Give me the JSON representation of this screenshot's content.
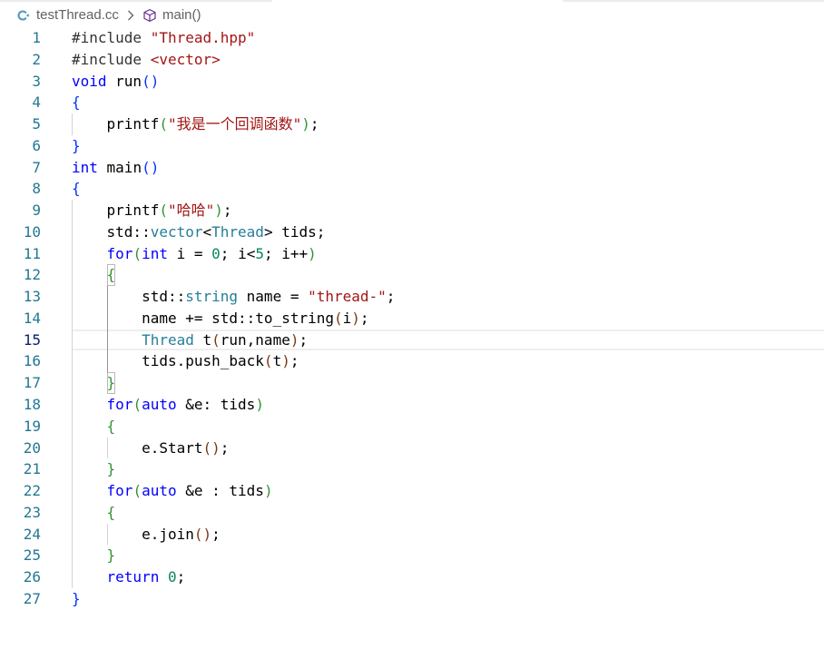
{
  "breadcrumb": {
    "file_icon": "cpp-file-icon",
    "file": "testThread.cc",
    "separator_icon": "chevron-right-icon",
    "symbol_icon": "method-cube-icon",
    "symbol": "main()"
  },
  "colors": {
    "line_number": "#237893",
    "line_number_active": "#0b216f",
    "breadcrumb_text": "#616161",
    "file_icon": "#519aba",
    "method_icon": "#652d90",
    "indent_guide": "#d3d3d3",
    "indent_guide_active": "#939393",
    "line_highlight_border": "#eeeeee",
    "bracket_match_border": "#b9b9b9",
    "tab_edge": "#ececec"
  },
  "editor": {
    "cursor_line": 15,
    "lines": [
      {
        "n": 1,
        "indent": 0,
        "tokens": [
          {
            "t": "#include ",
            "c": "#333333"
          },
          {
            "t": "\"Thread.hpp\"",
            "c": "#a31515"
          }
        ]
      },
      {
        "n": 2,
        "indent": 0,
        "tokens": [
          {
            "t": "#include ",
            "c": "#333333"
          },
          {
            "t": "<vector>",
            "c": "#a31515"
          }
        ]
      },
      {
        "n": 3,
        "indent": 0,
        "tokens": [
          {
            "t": "void",
            "c": "#0000ff"
          },
          {
            "t": " run",
            "c": "#000000"
          },
          {
            "t": "()",
            "c": "#0431fa"
          }
        ]
      },
      {
        "n": 4,
        "indent": 0,
        "tokens": [
          {
            "t": "{",
            "c": "#0431fa"
          }
        ]
      },
      {
        "n": 5,
        "indent": 1,
        "tokens": [
          {
            "t": "printf",
            "c": "#000000"
          },
          {
            "t": "(",
            "c": "#319331"
          },
          {
            "t": "\"我是一个回调函数\"",
            "c": "#a31515"
          },
          {
            "t": ")",
            "c": "#319331"
          },
          {
            "t": ";",
            "c": "#000000"
          }
        ]
      },
      {
        "n": 6,
        "indent": 0,
        "tokens": [
          {
            "t": "}",
            "c": "#0431fa"
          }
        ]
      },
      {
        "n": 7,
        "indent": 0,
        "tokens": [
          {
            "t": "int",
            "c": "#0000ff"
          },
          {
            "t": " main",
            "c": "#000000"
          },
          {
            "t": "()",
            "c": "#0431fa"
          }
        ]
      },
      {
        "n": 8,
        "indent": 0,
        "tokens": [
          {
            "t": "{",
            "c": "#0431fa"
          }
        ]
      },
      {
        "n": 9,
        "indent": 1,
        "tokens": [
          {
            "t": "printf",
            "c": "#000000"
          },
          {
            "t": "(",
            "c": "#319331"
          },
          {
            "t": "\"哈哈\"",
            "c": "#a31515"
          },
          {
            "t": ")",
            "c": "#319331"
          },
          {
            "t": ";",
            "c": "#000000"
          }
        ]
      },
      {
        "n": 10,
        "indent": 1,
        "tokens": [
          {
            "t": "std::",
            "c": "#000000"
          },
          {
            "t": "vector",
            "c": "#267f99"
          },
          {
            "t": "<",
            "c": "#000000"
          },
          {
            "t": "Thread",
            "c": "#267f99"
          },
          {
            "t": "> tids;",
            "c": "#000000"
          }
        ]
      },
      {
        "n": 11,
        "indent": 1,
        "tokens": [
          {
            "t": "for",
            "c": "#0000ff"
          },
          {
            "t": "(",
            "c": "#319331"
          },
          {
            "t": "int",
            "c": "#0000ff"
          },
          {
            "t": " i = ",
            "c": "#000000"
          },
          {
            "t": "0",
            "c": "#098658"
          },
          {
            "t": "; i<",
            "c": "#000000"
          },
          {
            "t": "5",
            "c": "#098658"
          },
          {
            "t": "; i++",
            "c": "#000000"
          },
          {
            "t": ")",
            "c": "#319331"
          }
        ]
      },
      {
        "n": 12,
        "indent": 1,
        "tokens": [
          {
            "t": "{",
            "c": "#319331",
            "match": true
          }
        ]
      },
      {
        "n": 13,
        "indent": 2,
        "tokens": [
          {
            "t": "std::",
            "c": "#000000"
          },
          {
            "t": "string",
            "c": "#267f99"
          },
          {
            "t": " name = ",
            "c": "#000000"
          },
          {
            "t": "\"thread-\"",
            "c": "#a31515"
          },
          {
            "t": ";",
            "c": "#000000"
          }
        ]
      },
      {
        "n": 14,
        "indent": 2,
        "tokens": [
          {
            "t": "name += std::to_string",
            "c": "#000000"
          },
          {
            "t": "(",
            "c": "#7b3814"
          },
          {
            "t": "i",
            "c": "#000000"
          },
          {
            "t": ")",
            "c": "#7b3814"
          },
          {
            "t": ";",
            "c": "#000000"
          }
        ]
      },
      {
        "n": 15,
        "indent": 2,
        "tokens": [
          {
            "t": "Thread",
            "c": "#267f99"
          },
          {
            "t": " t",
            "c": "#000000"
          },
          {
            "t": "(",
            "c": "#7b3814"
          },
          {
            "t": "run,name",
            "c": "#000000"
          },
          {
            "t": ")",
            "c": "#7b3814"
          },
          {
            "t": ";",
            "c": "#000000"
          }
        ]
      },
      {
        "n": 16,
        "indent": 2,
        "tokens": [
          {
            "t": "tids.push_back",
            "c": "#000000"
          },
          {
            "t": "(",
            "c": "#7b3814"
          },
          {
            "t": "t",
            "c": "#000000"
          },
          {
            "t": ")",
            "c": "#7b3814"
          },
          {
            "t": ";",
            "c": "#000000"
          }
        ]
      },
      {
        "n": 17,
        "indent": 1,
        "tokens": [
          {
            "t": "}",
            "c": "#319331",
            "match": true
          }
        ]
      },
      {
        "n": 18,
        "indent": 1,
        "tokens": [
          {
            "t": "for",
            "c": "#0000ff"
          },
          {
            "t": "(",
            "c": "#319331"
          },
          {
            "t": "auto",
            "c": "#0000ff"
          },
          {
            "t": " &e: tids",
            "c": "#000000"
          },
          {
            "t": ")",
            "c": "#319331"
          }
        ]
      },
      {
        "n": 19,
        "indent": 1,
        "tokens": [
          {
            "t": "{",
            "c": "#319331"
          }
        ]
      },
      {
        "n": 20,
        "indent": 2,
        "tokens": [
          {
            "t": "e.Start",
            "c": "#000000"
          },
          {
            "t": "()",
            "c": "#7b3814"
          },
          {
            "t": ";",
            "c": "#000000"
          }
        ]
      },
      {
        "n": 21,
        "indent": 1,
        "tokens": [
          {
            "t": "}",
            "c": "#319331"
          }
        ]
      },
      {
        "n": 22,
        "indent": 1,
        "tokens": [
          {
            "t": "for",
            "c": "#0000ff"
          },
          {
            "t": "(",
            "c": "#319331"
          },
          {
            "t": "auto",
            "c": "#0000ff"
          },
          {
            "t": " &e : tids",
            "c": "#000000"
          },
          {
            "t": ")",
            "c": "#319331"
          }
        ]
      },
      {
        "n": 23,
        "indent": 1,
        "tokens": [
          {
            "t": "{",
            "c": "#319331"
          }
        ]
      },
      {
        "n": 24,
        "indent": 2,
        "tokens": [
          {
            "t": "e.join",
            "c": "#000000"
          },
          {
            "t": "()",
            "c": "#7b3814"
          },
          {
            "t": ";",
            "c": "#000000"
          }
        ]
      },
      {
        "n": 25,
        "indent": 1,
        "tokens": [
          {
            "t": "}",
            "c": "#319331"
          }
        ]
      },
      {
        "n": 26,
        "indent": 1,
        "tokens": [
          {
            "t": "return ",
            "c": "#0000ff"
          },
          {
            "t": "0",
            "c": "#098658"
          },
          {
            "t": ";",
            "c": "#000000"
          }
        ]
      },
      {
        "n": 27,
        "indent": 0,
        "tokens": [
          {
            "t": "}",
            "c": "#0431fa"
          }
        ]
      }
    ]
  }
}
